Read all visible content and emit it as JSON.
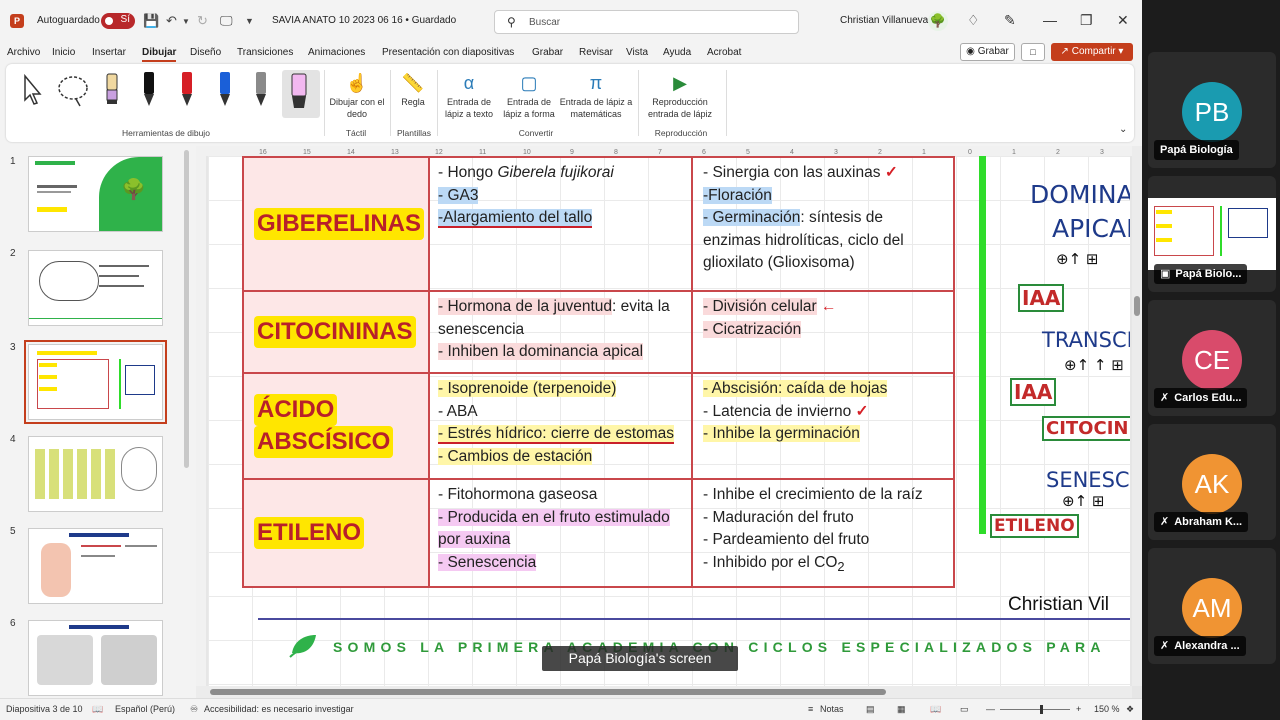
{
  "titlebar": {
    "app_icon": "P",
    "autosave_label": "Autoguardado",
    "autosave_state": "Sí",
    "doc_title": "SAVIA ANATO 10 2023 06 16 • Guardado",
    "search_placeholder": "Buscar",
    "user_name": "Christian Villanueva"
  },
  "menu": {
    "items": [
      "Archivo",
      "Inicio",
      "Insertar",
      "Dibujar",
      "Diseño",
      "Transiciones",
      "Animaciones",
      "Presentación con diapositivas",
      "Grabar",
      "Revisar",
      "Vista",
      "Ayuda",
      "Acrobat"
    ],
    "active": "Dibujar",
    "record_button": "Grabar",
    "share_button": "Compartir"
  },
  "ribbon": {
    "group_tools": "Herramientas de dibujo",
    "draw_with_finger": "Dibujar con el dedo",
    "ruler": "Regla",
    "group_touch": "Táctil",
    "group_templates": "Plantillas",
    "ink_to_text": "Entrada de lápiz a texto",
    "ink_to_shape": "Entrada de lápiz a forma",
    "ink_to_math": "Entrada de lápiz a matemáticas",
    "group_convert": "Convertir",
    "ink_replay": "Reproducción entrada de lápiz",
    "group_replay": "Reproducción"
  },
  "thumbnails": {
    "numbers": [
      "1",
      "2",
      "3",
      "4",
      "5",
      "6"
    ],
    "active_index": 3
  },
  "slide": {
    "rows": [
      {
        "name": "GIBERELINAS",
        "col2": [
          "- Hongo ",
          "Giberela fujikorai",
          "- GA3",
          "-Alargamiento del tallo"
        ],
        "col3": [
          "- Sinergia con las auxinas",
          "-Floración",
          "- Germinación",
          ": síntesis de enzimas hidrolíticas, ciclo del glioxilato (Glioxisoma)"
        ]
      },
      {
        "name": "CITOCININAS",
        "col2": [
          "- Hormona de la juventud",
          ": evita la senescencia",
          "- Inhiben la dominancia apical"
        ],
        "col3": [
          "- División celular",
          "- Cicatrización"
        ]
      },
      {
        "name1": "ÁCIDO",
        "name2": "ABSCÍSICO",
        "col2": [
          "- Isoprenoide (terpenoide)",
          "- ABA",
          "- Estrés hídrico: cierre de estomas",
          "- Cambios de estación"
        ],
        "col3": [
          "- Abscisión: caída de hojas",
          "- Latencia de invierno",
          "- Inhibe la germinación"
        ]
      },
      {
        "name": "ETILENO",
        "col2": [
          "- Fitohormona gaseosa",
          "- Producida en el fruto estimulado por auxina",
          "- Senescencia"
        ],
        "col3": [
          "- Inhibe el crecimiento de la raíz",
          "- Maduración del fruto",
          "- Pardeamiento del fruto",
          "- Inhibido por el CO",
          "2"
        ]
      }
    ],
    "side_notes": {
      "dominancia": "DOMINANCI",
      "apical": "APICAL",
      "iaa": "IAA",
      "transcrip": "TRANSCRIPC",
      "citocinin": "CITOCININ",
      "senescen": "SENESCEN",
      "etileno": "ETILENO"
    },
    "signature": "Christian Vil",
    "footer_banner": "SOMOS LA PRIMERA ACADEMIA CON CICLOS ESPECIALIZADOS PARA"
  },
  "statusbar": {
    "slide_counter": "Diapositiva 3 de 10",
    "language": "Español (Perú)",
    "accessibility": "Accesibilidad: es necesario investigar",
    "notes": "Notas",
    "zoom": "150 %"
  },
  "screen_share_caption": "Papá Biología's screen",
  "participants": [
    {
      "initials": "PB",
      "name": "Papá Biología",
      "color": "#1a9bb0",
      "muted": false
    },
    {
      "initials": "",
      "name": "Papá Biolo...",
      "color": "",
      "muted": false
    },
    {
      "initials": "CE",
      "name": "Carlos Edu...",
      "color": "#d94b6b",
      "muted": true
    },
    {
      "initials": "AK",
      "name": "Abraham K...",
      "color": "#f09433",
      "muted": true
    },
    {
      "initials": "AM",
      "name": "Alexandra ...",
      "color": "#f09433",
      "muted": true
    }
  ]
}
